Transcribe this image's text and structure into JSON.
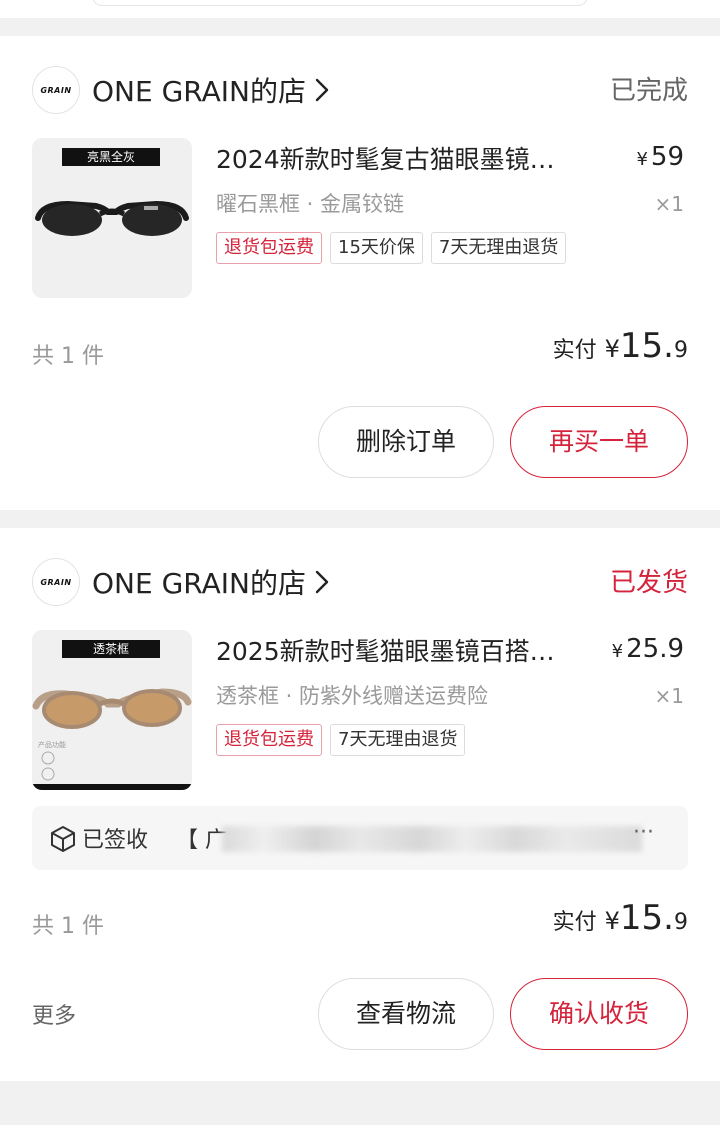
{
  "orders": [
    {
      "shop": {
        "logo_text": "GRAIN",
        "name": "ONE GRAIN的店"
      },
      "status": "已完成",
      "status_color": "#666666",
      "product": {
        "thumb_label": "亮黑全灰",
        "title": "2024新款时髦复古猫眼墨镜…",
        "price_symbol": "¥",
        "price": "59",
        "spec": "曜石黑框 · 金属铰链",
        "quantity": "×1",
        "tags": [
          "退货包运费",
          "15天价保",
          "7天无理由退货"
        ]
      },
      "item_count": "共 1 件",
      "paid_label": "实付",
      "paid_symbol": "¥",
      "paid_int": "15.",
      "paid_dec": "9",
      "buttons": [
        "删除订单",
        "再买一单"
      ]
    },
    {
      "shop": {
        "logo_text": "GRAIN",
        "name": "ONE GRAIN的店"
      },
      "status": "已发货",
      "status_color": "#d4233a",
      "product": {
        "thumb_label": "透茶框",
        "thumb_caption": "产品功能",
        "title": "2025新款时髦猫眼墨镜百搭…",
        "price_symbol": "¥",
        "price": "25.9",
        "spec": "透茶框 · 防紫外线赠送运费险",
        "quantity": "×1",
        "tags": [
          "退货包运费",
          "7天无理由退货"
        ]
      },
      "logistics": {
        "status": "已签收",
        "bracket": "【 广",
        "more": "···"
      },
      "item_count": "共 1 件",
      "paid_label": "实付",
      "paid_symbol": "¥",
      "paid_int": "15.",
      "paid_dec": "9",
      "more_label": "更多",
      "buttons": [
        "查看物流",
        "确认收货"
      ]
    }
  ],
  "theme": {
    "accent": "#d4233a",
    "muted": "#9a9a9a",
    "background": "#f1f1f1"
  }
}
